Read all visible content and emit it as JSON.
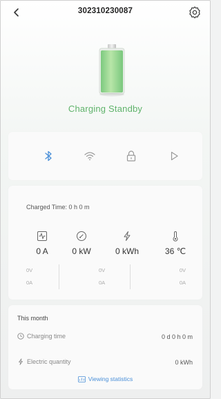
{
  "header": {
    "title": "302310230087"
  },
  "status": {
    "text": "Charging Standby"
  },
  "stats": {
    "charged_time": "Charged Time: 0 h 0 m",
    "metrics": [
      {
        "icon": "current-wave-icon",
        "value": "0 A"
      },
      {
        "icon": "power-gauge-icon",
        "value": "0 kW"
      },
      {
        "icon": "energy-bolt-icon",
        "value": "0 kWh"
      },
      {
        "icon": "thermometer-icon",
        "value": "36 ℃"
      }
    ],
    "phases": [
      {
        "v": "0V",
        "a": "0A"
      },
      {
        "v": "0V",
        "a": "0A"
      },
      {
        "v": "0V",
        "a": "0A"
      }
    ]
  },
  "month": {
    "title": "This month",
    "charging_time_label": "Charging time",
    "charging_time_value": "0 d 0 h 0 m",
    "electric_label": "Electric quantity",
    "electric_value": "0 kWh",
    "view_stats": "Viewing statistics"
  },
  "colors": {
    "accent_green": "#5fb36b",
    "link_blue": "#4a8fd8"
  }
}
